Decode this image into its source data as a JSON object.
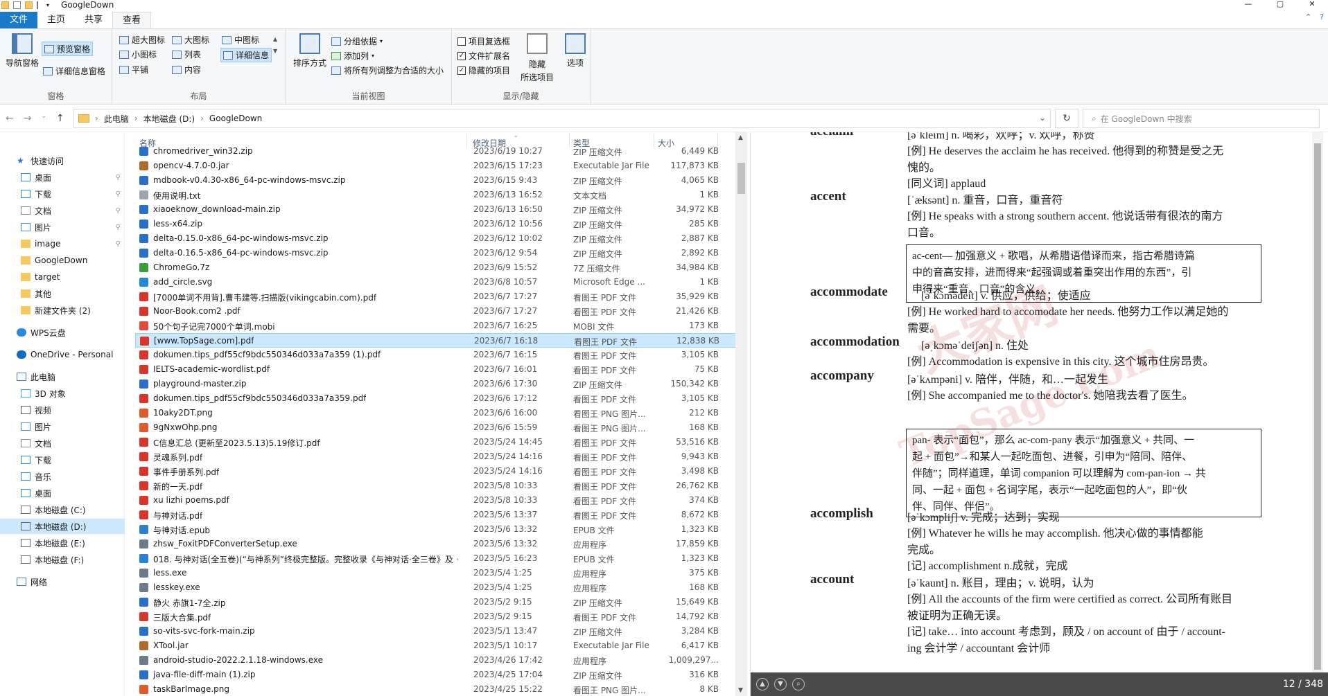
{
  "window": {
    "title": "GoogleDown",
    "controls": [
      "—",
      "▢",
      "✕"
    ]
  },
  "ribbon_tabs": [
    "文件",
    "主页",
    "共享",
    "查看"
  ],
  "ribbon": {
    "panes": {
      "nav_pane": "导航窗格",
      "preview_pane": "预览窗格",
      "details_pane": "详细信息窗格",
      "label": "窗格"
    },
    "layout": {
      "xl": "超大图标",
      "large": "大图标",
      "medium": "中图标",
      "small": "小图标",
      "list": "列表",
      "details": "详细信息",
      "tiles": "平铺",
      "content": "内容",
      "label": "布局"
    },
    "view": {
      "sort": "排序方式",
      "group": "分组依据",
      "addcol": "添加列",
      "fitcols": "将所有列调整为合适的大小",
      "label": "当前视图"
    },
    "showhide": {
      "checkboxes": "项目复选框",
      "extensions": "文件扩展名",
      "hidden": "隐藏的项目",
      "hide_sel": "隐藏",
      "hide_sel2": "所选项目",
      "options": "选项",
      "label": "显示/隐藏"
    }
  },
  "address": {
    "parts": [
      "此电脑",
      "本地磁盘 (D:)",
      "GoogleDown"
    ],
    "search_placeholder": "在 GoogleDown 中搜索"
  },
  "nav": {
    "items": [
      {
        "label": "快速访问",
        "icon": "star-icon",
        "color": "#2a7ad6",
        "indent": 0,
        "pin": false
      },
      {
        "label": "桌面",
        "icon": "desktop-icon",
        "color": "#2b8bd8",
        "indent": 1,
        "pin": true
      },
      {
        "label": "下载",
        "icon": "download-icon",
        "color": "#2b8bd8",
        "indent": 1,
        "pin": true
      },
      {
        "label": "文档",
        "icon": "document-icon",
        "color": "#888",
        "indent": 1,
        "pin": true
      },
      {
        "label": "图片",
        "icon": "pictures-icon",
        "color": "#4a90c8",
        "indent": 1,
        "pin": true
      },
      {
        "label": "image",
        "icon": "folder-icon",
        "color": "#f6c85f",
        "indent": 1,
        "pin": true
      },
      {
        "label": "GoogleDown",
        "icon": "folder-icon",
        "color": "#f6c85f",
        "indent": 1,
        "pin": false
      },
      {
        "label": "target",
        "icon": "folder-icon",
        "color": "#f6c85f",
        "indent": 1,
        "pin": false
      },
      {
        "label": "其他",
        "icon": "folder-icon",
        "color": "#f6c85f",
        "indent": 1,
        "pin": false
      },
      {
        "label": "新建文件夹 (2)",
        "icon": "folder-icon",
        "color": "#f6c85f",
        "indent": 1,
        "pin": false
      },
      {
        "label": "WPS云盘",
        "icon": "cloud-icon",
        "color": "#2b8bd8",
        "indent": 0,
        "pin": false
      },
      {
        "label": "OneDrive - Personal",
        "icon": "cloud-icon",
        "color": "#0f6cbd",
        "indent": 0,
        "pin": false
      },
      {
        "label": "此电脑",
        "icon": "computer-icon",
        "color": "#3a78c2",
        "indent": 0,
        "pin": false
      },
      {
        "label": "3D 对象",
        "icon": "cube-icon",
        "color": "#4aa3df",
        "indent": 1,
        "pin": false
      },
      {
        "label": "视频",
        "icon": "video-icon",
        "color": "#555",
        "indent": 1,
        "pin": false
      },
      {
        "label": "图片",
        "icon": "pictures-icon",
        "color": "#4a90c8",
        "indent": 1,
        "pin": false
      },
      {
        "label": "文档",
        "icon": "document-icon",
        "color": "#888",
        "indent": 1,
        "pin": false
      },
      {
        "label": "下载",
        "icon": "download-icon",
        "color": "#2b8bd8",
        "indent": 1,
        "pin": false
      },
      {
        "label": "音乐",
        "icon": "music-icon",
        "color": "#2b8bd8",
        "indent": 1,
        "pin": false
      },
      {
        "label": "桌面",
        "icon": "desktop-icon",
        "color": "#2b8bd8",
        "indent": 1,
        "pin": false
      },
      {
        "label": "本地磁盘 (C:)",
        "icon": "drive-icon",
        "color": "#666",
        "indent": 1,
        "pin": false
      },
      {
        "label": "本地磁盘 (D:)",
        "icon": "drive-icon",
        "color": "#666",
        "indent": 1,
        "pin": false,
        "selected": true
      },
      {
        "label": "本地磁盘 (E:)",
        "icon": "drive-icon",
        "color": "#666",
        "indent": 1,
        "pin": false
      },
      {
        "label": "本地磁盘 (F:)",
        "icon": "drive-icon",
        "color": "#666",
        "indent": 1,
        "pin": false
      },
      {
        "label": "网络",
        "icon": "network-icon",
        "color": "#3a78c2",
        "indent": 0,
        "pin": false
      }
    ]
  },
  "columns": {
    "name": "名称",
    "date": "修改日期",
    "type": "类型",
    "size": "大小"
  },
  "files": [
    {
      "name": "chromedriver_win32.zip",
      "date": "2023/6/19 10:27",
      "type": "ZIP 压缩文件",
      "size": "6,449 KB",
      "icon": "zip"
    },
    {
      "name": "opencv-4.7.0-0.jar",
      "date": "2023/6/15 17:23",
      "type": "Executable Jar File",
      "size": "117,873 KB",
      "icon": "jar"
    },
    {
      "name": "mdbook-v0.4.30-x86_64-pc-windows-msvc.zip",
      "date": "2023/6/15 9:43",
      "type": "ZIP 压缩文件",
      "size": "4,065 KB",
      "icon": "zip"
    },
    {
      "name": "使用说明.txt",
      "date": "2023/6/13 16:52",
      "type": "文本文档",
      "size": "1 KB",
      "icon": "txt"
    },
    {
      "name": "xiaoeknow_download-main.zip",
      "date": "2023/6/13 16:50",
      "type": "ZIP 压缩文件",
      "size": "34,972 KB",
      "icon": "zip"
    },
    {
      "name": "less-x64.zip",
      "date": "2023/6/12 10:56",
      "type": "ZIP 压缩文件",
      "size": "285 KB",
      "icon": "zip"
    },
    {
      "name": "delta-0.15.0-x86_64-pc-windows-msvc.zip",
      "date": "2023/6/12 10:02",
      "type": "ZIP 压缩文件",
      "size": "2,887 KB",
      "icon": "zip"
    },
    {
      "name": "delta-0.16.5-x86_64-pc-windows-msvc.zip",
      "date": "2023/6/12 9:54",
      "type": "ZIP 压缩文件",
      "size": "2,892 KB",
      "icon": "zip"
    },
    {
      "name": "ChromeGo.7z",
      "date": "2023/6/9 15:52",
      "type": "7Z 压缩文件",
      "size": "34,984 KB",
      "icon": "7z"
    },
    {
      "name": "add_circle.svg",
      "date": "2023/6/8 10:57",
      "type": "Microsoft Edge ...",
      "size": "1 KB",
      "icon": "svg"
    },
    {
      "name": "[7000单词不用背].曹韦建等.扫描版(vikingcabin.com).pdf",
      "date": "2023/6/7 17:27",
      "type": "看图王 PDF 文件",
      "size": "35,929 KB",
      "icon": "pdf"
    },
    {
      "name": "Noor-Book.com2 .pdf",
      "date": "2023/6/7 17:27",
      "type": "看图王 PDF 文件",
      "size": "21,426 KB",
      "icon": "pdf"
    },
    {
      "name": "50个句子记完7000个单词.mobi",
      "date": "2023/6/7 16:25",
      "type": "MOBI 文件",
      "size": "173 KB",
      "icon": "mobi"
    },
    {
      "name": "[www.TopSage.com].pdf",
      "date": "2023/6/7 16:18",
      "type": "看图王 PDF 文件",
      "size": "12,838 KB",
      "icon": "pdf",
      "selected": true
    },
    {
      "name": "dokumen.tips_pdf55cf9bdc550346d033a7a359 (1).pdf",
      "date": "2023/6/7 16:15",
      "type": "看图王 PDF 文件",
      "size": "3,105 KB",
      "icon": "pdf"
    },
    {
      "name": "IELTS-academic-wordlist.pdf",
      "date": "2023/6/7 16:01",
      "type": "看图王 PDF 文件",
      "size": "75 KB",
      "icon": "pdf"
    },
    {
      "name": "playground-master.zip",
      "date": "2023/6/6 17:30",
      "type": "ZIP 压缩文件",
      "size": "150,342 KB",
      "icon": "zip"
    },
    {
      "name": "dokumen.tips_pdf55cf9bdc550346d033a7a359.pdf",
      "date": "2023/6/6 17:12",
      "type": "看图王 PDF 文件",
      "size": "3,105 KB",
      "icon": "pdf"
    },
    {
      "name": "10aky2DT.png",
      "date": "2023/6/6 16:00",
      "type": "看图王 PNG 图片...",
      "size": "212 KB",
      "icon": "png"
    },
    {
      "name": "9gNxwOhp.png",
      "date": "2023/6/6 15:59",
      "type": "看图王 PNG 图片...",
      "size": "168 KB",
      "icon": "png"
    },
    {
      "name": "C信息汇总 (更新至2023.5.13)5.19修订.pdf",
      "date": "2023/5/24 14:45",
      "type": "看图王 PDF 文件",
      "size": "53,516 KB",
      "icon": "pdf"
    },
    {
      "name": "灵魂系列.pdf",
      "date": "2023/5/24 14:16",
      "type": "看图王 PDF 文件",
      "size": "9,943 KB",
      "icon": "pdf"
    },
    {
      "name": "事件手册系列.pdf",
      "date": "2023/5/24 14:16",
      "type": "看图王 PDF 文件",
      "size": "3,498 KB",
      "icon": "pdf"
    },
    {
      "name": "新的一天.pdf",
      "date": "2023/5/8 10:33",
      "type": "看图王 PDF 文件",
      "size": "26,762 KB",
      "icon": "pdf"
    },
    {
      "name": "xu lizhi poems.pdf",
      "date": "2023/5/8 10:33",
      "type": "看图王 PDF 文件",
      "size": "374 KB",
      "icon": "pdf"
    },
    {
      "name": "与神对话.pdf",
      "date": "2023/5/6 13:37",
      "type": "看图王 PDF 文件",
      "size": "8,672 KB",
      "icon": "pdf"
    },
    {
      "name": "与神对话.epub",
      "date": "2023/5/6 13:32",
      "type": "EPUB 文件",
      "size": "1,323 KB",
      "icon": "epub"
    },
    {
      "name": "zhsw_FoxitPDFConverterSetup.exe",
      "date": "2023/5/6 13:32",
      "type": "应用程序",
      "size": "17,859 KB",
      "icon": "exe"
    },
    {
      "name": "018. 与神对话(全五卷)(“与神系列”终极完整版。完整收录《与神对话·全三卷》及《...",
      "date": "2023/5/5 16:23",
      "type": "EPUB 文件",
      "size": "1,323 KB",
      "icon": "epub"
    },
    {
      "name": "less.exe",
      "date": "2023/5/4 1:25",
      "type": "应用程序",
      "size": "375 KB",
      "icon": "exe"
    },
    {
      "name": "lesskey.exe",
      "date": "2023/5/4 1:25",
      "type": "应用程序",
      "size": "168 KB",
      "icon": "exe"
    },
    {
      "name": "静火 赤旗1-7全.zip",
      "date": "2023/5/2 9:15",
      "type": "ZIP 压缩文件",
      "size": "15,649 KB",
      "icon": "zip"
    },
    {
      "name": "三版大合集.pdf",
      "date": "2023/5/2 9:15",
      "type": "看图王 PDF 文件",
      "size": "14,792 KB",
      "icon": "pdf"
    },
    {
      "name": "so-vits-svc-fork-main.zip",
      "date": "2023/5/1 13:47",
      "type": "ZIP 压缩文件",
      "size": "3,284 KB",
      "icon": "zip"
    },
    {
      "name": "XTool.jar",
      "date": "2023/5/1 10:17",
      "type": "Executable Jar File",
      "size": "6,417 KB",
      "icon": "jar"
    },
    {
      "name": "android-studio-2022.2.1.18-windows.exe",
      "date": "2023/4/26 17:42",
      "type": "应用程序",
      "size": "1,009,297...",
      "icon": "exe"
    },
    {
      "name": "java-file-diff-main (1).zip",
      "date": "2023/4/25 17:04",
      "type": "ZIP 压缩文件",
      "size": "316 KB",
      "icon": "zip"
    },
    {
      "name": "taskBarImage.png",
      "date": "2023/4/25 15:22",
      "type": "看图王 PNG 图片...",
      "size": "8 KB",
      "icon": "png"
    }
  ],
  "icon_colors": {
    "zip": "#2a6fc9",
    "jar": "#b06a2c",
    "txt": "#9aa5b1",
    "7z": "#3c9b3c",
    "svg": "#1f8ad8",
    "pdf": "#d9352a",
    "mobi": "#e04b3c",
    "png": "#e25a2a",
    "epub": "#2c7fd1",
    "exe": "#6b7a8c"
  },
  "preview": {
    "entries": [
      {
        "head": "acclaim",
        "lines": [
          "[əˈkleim] n. 喝彩，欢呼；v. 欢呼，称赞",
          "[例] He deserves the acclaim he has received. 他得到的称赞是受之无",
          "愧的。",
          "[同义词] applaud"
        ]
      },
      {
        "head": "accent",
        "lines": [
          "[ˈæksənt] n. 重音，口音，重音符",
          "[例] He speaks with a strong southern accent. 他说话带有很浓的南方",
          "口音。"
        ]
      },
      {
        "head": "accommodate",
        "lines": [
          "[əˈkɔmədeit] v. 供应，供给；使适应",
          "[例] He worked hard to accomodate her needs. 他努力工作以满足她的",
          "需要。"
        ]
      },
      {
        "head": "accommodation",
        "lines": [
          "[əˌkɔməˈdeiʃən] n. 住处",
          "[例] Accommodation is expensive in this city. 这个城市住房昂贵。"
        ]
      },
      {
        "head": "accompany",
        "lines": [
          "[əˈkʌmpəni] v. 陪伴，伴随，和…一起发生",
          "[例] She accompanied me to the doctor's. 她陪我去看了医生。"
        ]
      },
      {
        "head": "accomplish",
        "lines": [
          "[əˈkɔmpliʃ] v. 完成；达到；实现",
          "[例] Whatever he wills he may accomplish. 他决心做的事情都能",
          "完成。",
          "[记] accomplishment n.成就，完成"
        ]
      },
      {
        "head": "account",
        "lines": [
          "[əˈkaunt] n. 账目，理由；v. 说明，认为",
          "[例] All the accounts of the firm were certified as correct. 公司所有账目",
          "被证明为正确无误。",
          "[记] take… into account 考虑到，顾及 / on account of 由于 / account-",
          "ing 会计学 / accountant 会计师"
        ]
      }
    ],
    "box1": [
      "ac-cent— 加强意义 + 歌唱，从希腊语借译而来，指古希腊诗篇",
      "中的音高安排，进而得来“起强调或着重突出作用的东西”，引",
      "申得来“重音、口音”的含义。"
    ],
    "box2": [
      "pan- 表示“面包”，那么 ac-com-pany 表示“加强意义 + 共同、一",
      "起 + 面包”→和某人一起吃面包、进餐，引申为“陪同、陪伴、",
      "伴随”；同样道理，单词 companion 可以理解为 com-pan-ion → 共",
      "同、一起 + 面包 + 名词字尾，表示“一起吃面包的人”，即“伙",
      "伴、同伴、伴侣”。"
    ],
    "watermark": [
      "大家网",
      "TopSage.com"
    ],
    "page": "12 / 348"
  }
}
